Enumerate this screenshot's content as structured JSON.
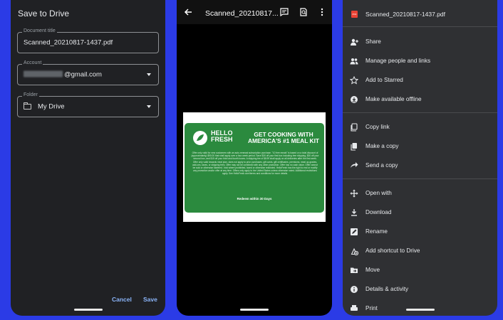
{
  "save_dialog": {
    "title": "Save to Drive",
    "document_title_label": "Document title",
    "document_title_value": "Scanned_20210817-1437.pdf",
    "account_label": "Account",
    "account_value": "@gmail.com",
    "folder_label": "Folder",
    "folder_value": "My Drive",
    "cancel_label": "Cancel",
    "save_label": "Save"
  },
  "viewer": {
    "title": "Scanned_20210817...",
    "card": {
      "brand": "HELLO FRESH",
      "headline": "GET COOKING WITH AMERICA'S #1 MEAL KIT",
      "fine_print": "Offer only valid for new customers with an auto-renewal subscription purchase. \"10 free meals\" is based on a total discount of (approximately) $90.00 that shall apply over a four-week period. Save $30 off your first box including free shipping, $30 off your second box, and $15 off your third and fourth boxes. A shipping fee of $8.99 shall apply on all deliveries after the first week. Offer only valid towards meal plan, does not apply to prior purchases, gift cards, gift certificates, premiums, meal up-grades, add-ons, taxes, or shipping fees. Offer may not be combined with any other promotion. Offer has no cash value. Offer cannot be sold or otherwise bartered. Void where prohibited, taxed or otherwise restricted. HelloFresh has the right to end or modify any promotion and/or offer at any time. Offers only apply to the United States unless otherwise noted. Additional restrictions apply. See HelloFresh.com/terms and conditions for more details.",
      "redeem": "Redeem within 30 Days"
    }
  },
  "menu": {
    "file_name": "Scanned_20210817-1437.pdf",
    "items": [
      {
        "label": "Share",
        "icon": "person-add-icon"
      },
      {
        "label": "Manage people and links",
        "icon": "people-icon"
      },
      {
        "label": "Add to Starred",
        "icon": "star-icon"
      },
      {
        "label": "Make available offline",
        "icon": "offline-icon"
      },
      {
        "label": "Copy link",
        "icon": "link-copy-icon"
      },
      {
        "label": "Make a copy",
        "icon": "copy-icon"
      },
      {
        "label": "Send a copy",
        "icon": "send-icon"
      },
      {
        "label": "Open with",
        "icon": "open-with-icon"
      },
      {
        "label": "Download",
        "icon": "download-icon"
      },
      {
        "label": "Rename",
        "icon": "rename-icon"
      },
      {
        "label": "Add shortcut to Drive",
        "icon": "shortcut-icon"
      },
      {
        "label": "Move",
        "icon": "move-icon"
      },
      {
        "label": "Details & activity",
        "icon": "info-icon"
      },
      {
        "label": "Print",
        "icon": "print-icon"
      }
    ]
  },
  "colors": {
    "background": "#2b3be6",
    "accent": "#8ab4f8",
    "card_green": "#2b8a3e"
  }
}
